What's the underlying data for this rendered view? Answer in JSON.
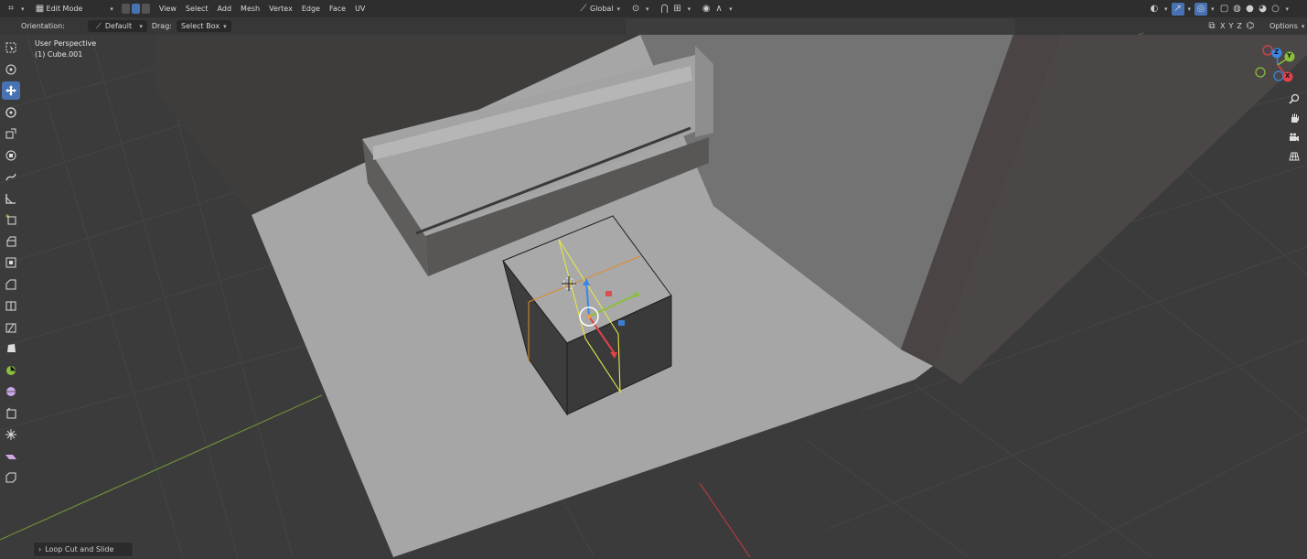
{
  "header": {
    "editor_type_icon": "axis-grid-icon",
    "mode": "Edit Mode",
    "menus": [
      "View",
      "Select",
      "Add",
      "Mesh",
      "Vertex",
      "Edge",
      "Face",
      "UV"
    ],
    "transform_orientation": "Global",
    "pivot_icon": "pivot-icon",
    "snap_icon": "magnet-icon",
    "proportional_icon": "proportional-edit-icon"
  },
  "tool_settings": {
    "orientation_label": "Orientation:",
    "orientation_value": "Default",
    "drag_label": "Drag:",
    "drag_value": "Select Box",
    "axes": [
      "X",
      "Y",
      "Z"
    ],
    "options_label": "Options"
  },
  "viewport": {
    "view_name": "User Perspective",
    "object_name": "(1) Cube.001"
  },
  "toolbar": {
    "tools": [
      "select-box-icon",
      "cursor-icon",
      "move-icon",
      "rotate-icon",
      "scale-icon",
      "transform-icon",
      "annotate-icon",
      "measure-icon",
      "add-cube-icon",
      "extrude-region-icon",
      "inset-faces-icon",
      "bevel-icon",
      "loop-cut-icon",
      "knife-icon",
      "poly-build-icon",
      "spin-icon",
      "smooth-icon",
      "edge-slide-icon",
      "shrink-fatten-icon",
      "shear-icon",
      "rip-region-icon"
    ],
    "active_tool": "move-icon"
  },
  "nav_gizmo": {
    "axes": [
      "X",
      "Y",
      "Z"
    ],
    "colors": {
      "x": "#e2424a",
      "y": "#8bbf3b",
      "z": "#3c86e6"
    }
  },
  "last_operation": {
    "label": "Loop Cut and Slide"
  }
}
